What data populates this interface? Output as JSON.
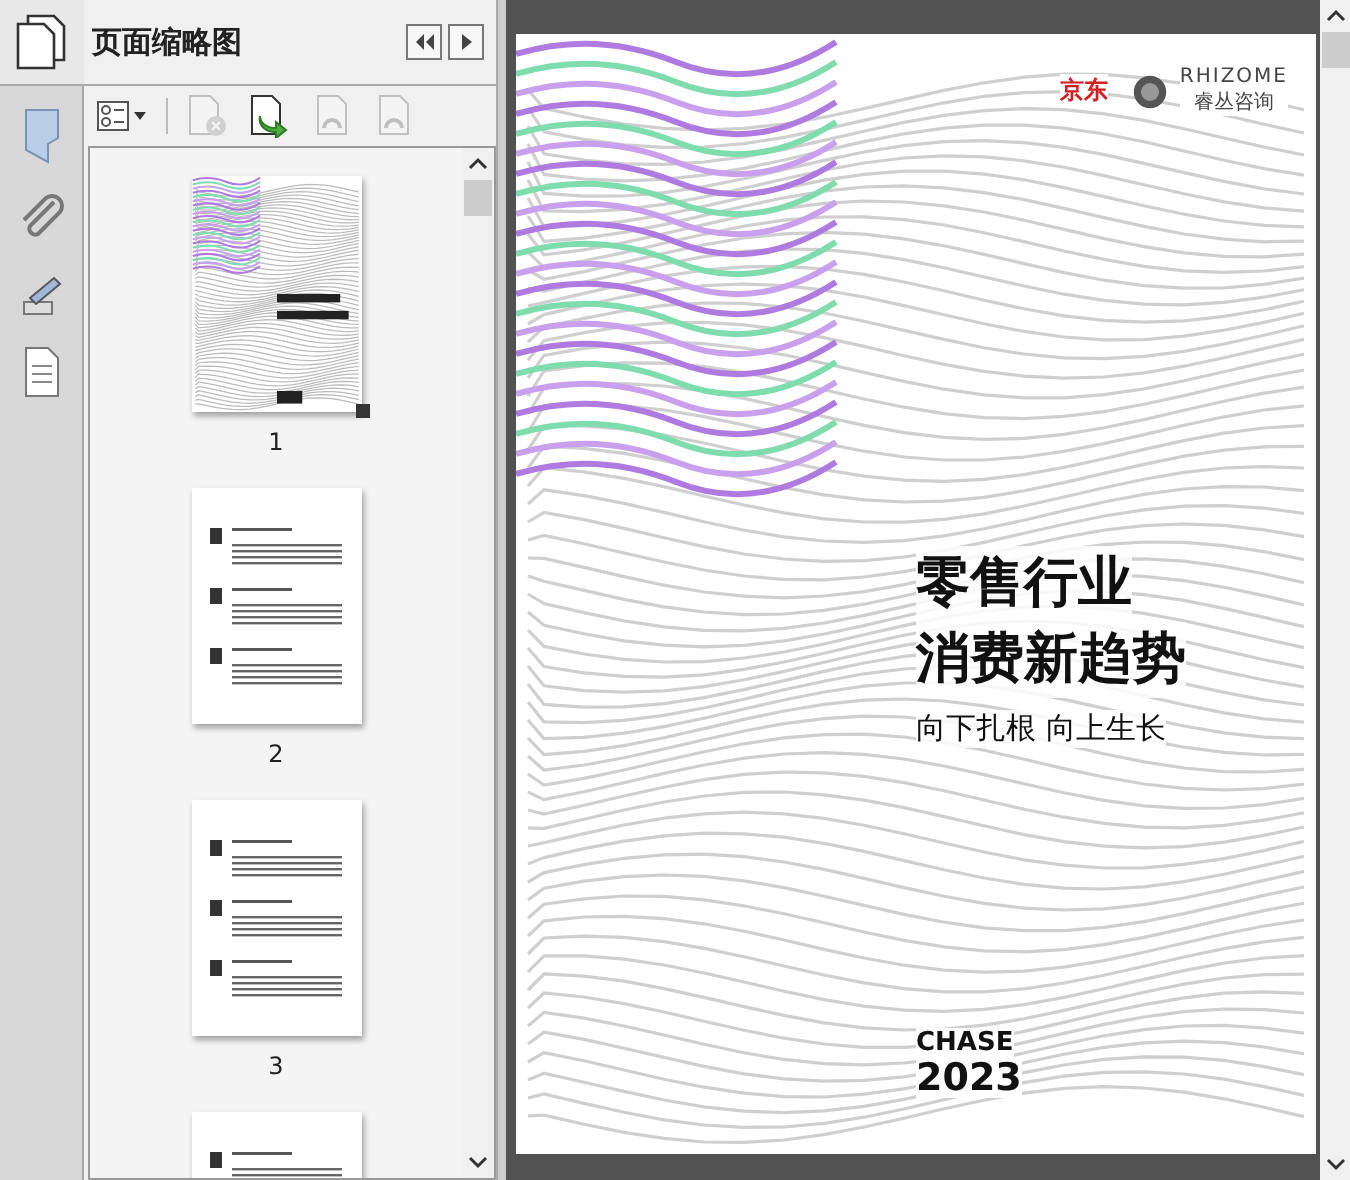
{
  "panel": {
    "title": "页面缩略图"
  },
  "toolbar": [
    {
      "kind": "options",
      "disabled": false
    },
    {
      "kind": "delete",
      "disabled": true
    },
    {
      "kind": "insert",
      "disabled": false
    },
    {
      "kind": "rotate-left",
      "disabled": true
    },
    {
      "kind": "rotate-right",
      "disabled": true
    }
  ],
  "thumbnails": [
    {
      "label": "1",
      "kind": "cover"
    },
    {
      "label": "2",
      "kind": "text"
    },
    {
      "label": "3",
      "kind": "text"
    },
    {
      "kind": "text"
    }
  ],
  "document": {
    "logos": [
      {
        "name": "京东",
        "kind": "jd"
      },
      {
        "name": "RHIZOME",
        "sub": "睿丛咨询",
        "kind": "rhizome"
      }
    ],
    "title_lines": [
      "零售行业",
      "消费新趋势"
    ],
    "subtitle": "向下扎根 向上生长",
    "brand": "CHASE",
    "year": "2023"
  }
}
